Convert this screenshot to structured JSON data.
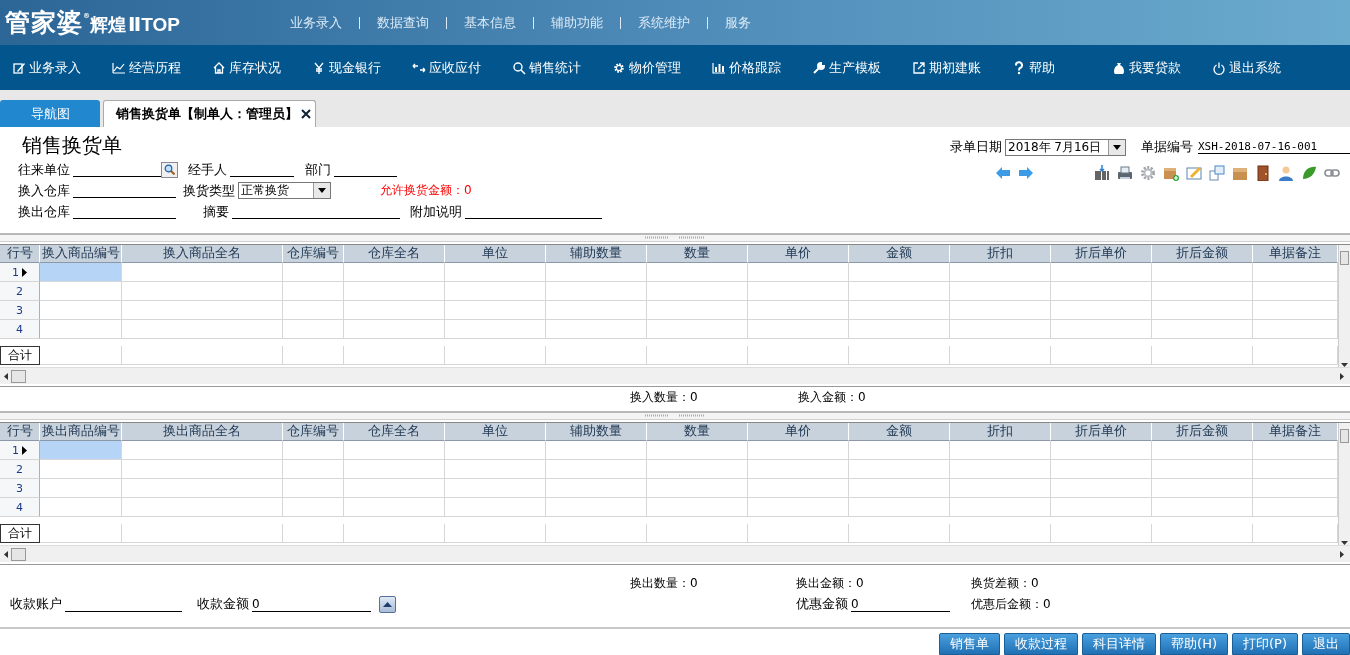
{
  "header": {
    "logo": {
      "brand": "管家婆",
      "mark": "®",
      "series": "辉煌",
      "edition": "Ⅱ",
      "tier": "TOP"
    },
    "menu": [
      "业务录入",
      "数据查询",
      "基本信息",
      "辅助功能",
      "系统维护",
      "服务"
    ]
  },
  "nav": [
    {
      "label": "业务录入"
    },
    {
      "label": "经营历程"
    },
    {
      "label": "库存状况"
    },
    {
      "label": "现金银行"
    },
    {
      "label": "应收应付"
    },
    {
      "label": "销售统计"
    },
    {
      "label": "物价管理"
    },
    {
      "label": "价格跟踪"
    },
    {
      "label": "生产模板"
    },
    {
      "label": "期初建账"
    },
    {
      "label": "帮助"
    },
    {
      "label": "我要贷款"
    },
    {
      "label": "退出系统"
    }
  ],
  "tabs": [
    {
      "label": "导航图",
      "selected": false,
      "closable": false
    },
    {
      "label": "销售换货单【制单人：管理员】",
      "selected": true,
      "closable": true
    }
  ],
  "form": {
    "title": "销售换货单",
    "rows": [
      {
        "fields": [
          {
            "kind": "lookup",
            "label": "往来单位"
          },
          {
            "kind": "line",
            "label": "经手人"
          },
          {
            "kind": "line",
            "label": "部门"
          }
        ]
      },
      {
        "fields": [
          {
            "kind": "line",
            "label": "换入仓库"
          },
          {
            "kind": "select",
            "label": "换货类型",
            "value": "正常换货"
          },
          {
            "kind": "note",
            "text": "允许换货金额：0"
          }
        ]
      },
      {
        "fields": [
          {
            "kind": "line",
            "label": "换出仓库"
          },
          {
            "kind": "line",
            "label": "摘要"
          },
          {
            "kind": "line",
            "label": "附加说明"
          }
        ]
      }
    ],
    "date": {
      "label": "录单日期",
      "value": "2018年 7月16日"
    },
    "number": {
      "label": "单据编号",
      "value": "XSH-2018-07-16-001"
    }
  },
  "grids": [
    {
      "columns": [
        "行号",
        "换入商品编号",
        "换入商品全名",
        "仓库编号",
        "仓库全名",
        "单位",
        "辅助数量",
        "数量",
        "单价",
        "金额",
        "折扣",
        "折后单价",
        "折后金额",
        "单据备注"
      ],
      "rows": [
        {
          "number": "1",
          "current": true
        },
        {
          "number": "2",
          "current": false
        },
        {
          "number": "3",
          "current": false
        },
        {
          "number": "4",
          "current": false
        }
      ],
      "total_label": "合计",
      "summary": [
        "换入数量：0",
        "换入金额：0"
      ]
    },
    {
      "columns": [
        "行号",
        "换出商品编号",
        "换出商品全名",
        "仓库编号",
        "仓库全名",
        "单位",
        "辅助数量",
        "数量",
        "单价",
        "金额",
        "折扣",
        "折后单价",
        "折后金额",
        "单据备注"
      ],
      "rows": [
        {
          "number": "1",
          "current": true
        },
        {
          "number": "2",
          "current": false
        },
        {
          "number": "3",
          "current": false
        },
        {
          "number": "4",
          "current": false
        }
      ],
      "total_label": "合计"
    }
  ],
  "footer": {
    "stats": [
      "换出数量：0",
      "换出金额：0",
      "换货差额：0"
    ],
    "account": {
      "label": "收款账户"
    },
    "received": {
      "label": "收款金额",
      "value": "0"
    },
    "discount": {
      "label": "优惠金额",
      "value": "0"
    },
    "after_discount": "优惠后金额：0"
  },
  "buttons": [
    "销售单",
    "收款过程",
    "科目详情",
    "帮助(H)",
    "打印(P)",
    "退出"
  ]
}
